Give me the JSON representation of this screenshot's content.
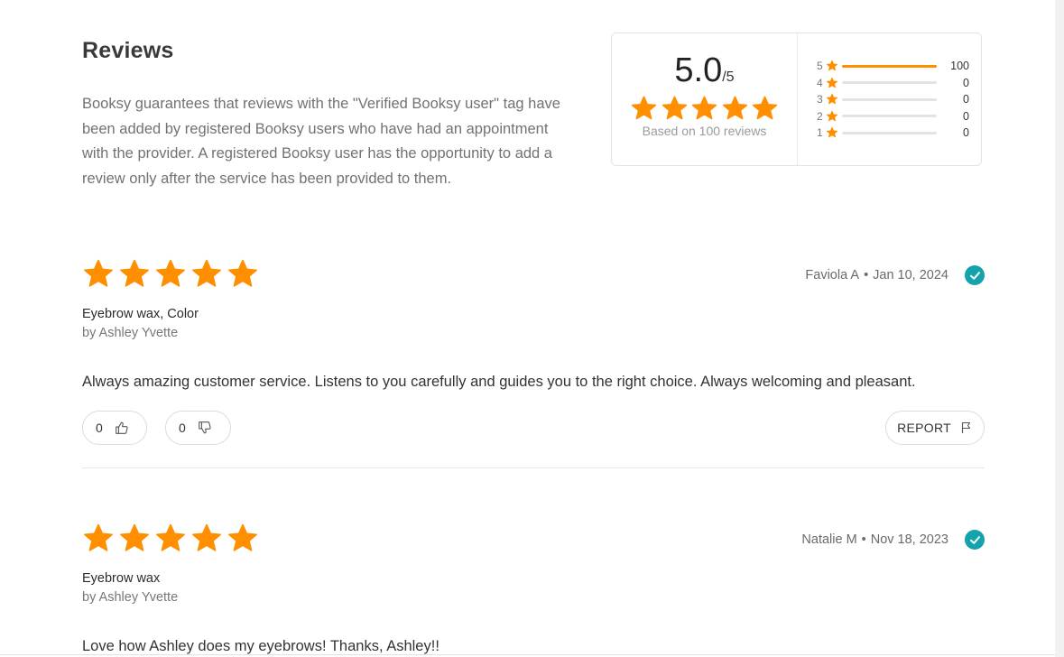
{
  "page": {
    "title": "Reviews",
    "intro": "Booksy guarantees that reviews with the \"Verified Booksy user\" tag have been added by registered Booksy users who have had an appointment with the provider. A registered Booksy user has the opportunity to add a review only after the service has been provided to them."
  },
  "summary": {
    "score": "5.0",
    "out_of": "/5",
    "star_rating": 5,
    "based_on": "Based on 100 reviews",
    "distribution": [
      {
        "stars": "5",
        "count": "100",
        "fraction": 1.0
      },
      {
        "stars": "4",
        "count": "0",
        "fraction": 0
      },
      {
        "stars": "3",
        "count": "0",
        "fraction": 0
      },
      {
        "stars": "2",
        "count": "0",
        "fraction": 0
      },
      {
        "stars": "1",
        "count": "0",
        "fraction": 0
      }
    ]
  },
  "reviews": [
    {
      "rating": 5,
      "author": "Faviola A",
      "separator": "•",
      "date": "Jan 10, 2024",
      "verified": true,
      "service": "Eyebrow wax, Color",
      "by": "by Ashley Yvette",
      "text": "Always amazing customer service. Listens to you carefully and guides you to the right choice. Always welcoming and pleasant.",
      "likes": "0",
      "dislikes": "0",
      "report_label": "REPORT"
    },
    {
      "rating": 5,
      "author": "Natalie M",
      "separator": "•",
      "date": "Nov 18, 2023",
      "verified": true,
      "service": "Eyebrow wax",
      "by": "by Ashley Yvette",
      "text": "Love how Ashley does my eyebrows! Thanks, Ashley!!"
    }
  ],
  "colors": {
    "star": "#ff8f00",
    "verified": "#12a3ad",
    "bar_empty": "#e3e3e3"
  },
  "icons": {
    "star": "star-icon",
    "verified": "check-circle-icon",
    "like": "thumbs-up-icon",
    "dislike": "thumbs-down-icon",
    "report": "flag-icon"
  }
}
